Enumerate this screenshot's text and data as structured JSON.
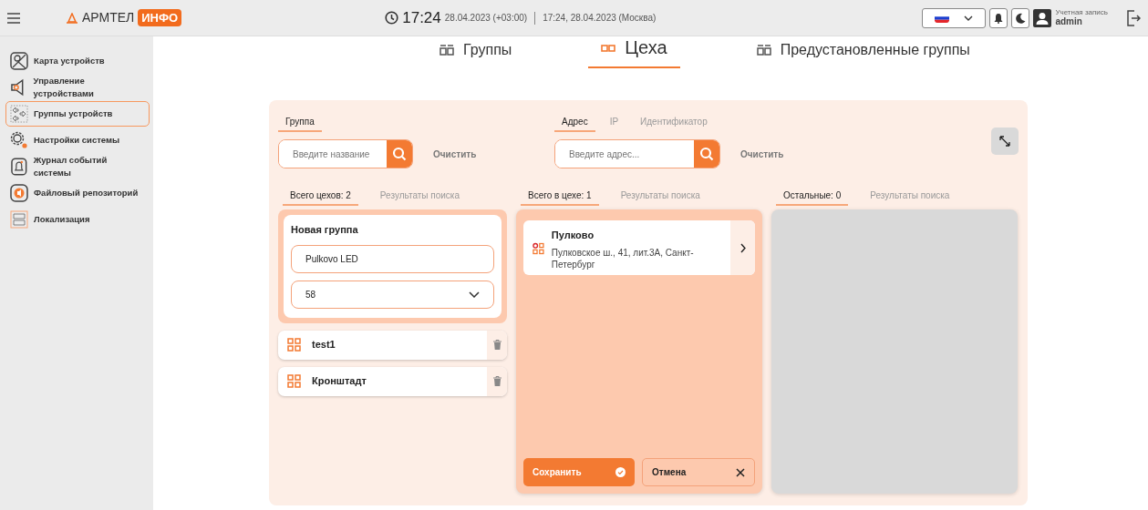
{
  "header": {
    "brand": "АРМТЕЛ",
    "brand_badge": "ИНФО",
    "time": "17:24",
    "date": "28.04.2023 (+03:00)",
    "server_time": "17:24, 28.04.2023 (Москва)",
    "account_label": "Учетная запись",
    "user": "admin"
  },
  "sidebar": {
    "items": [
      {
        "label": "Карта устройств",
        "selected": false
      },
      {
        "label": "Управление устройствами",
        "selected": false
      },
      {
        "label": "Группы устройств",
        "selected": true
      },
      {
        "label": "Настройки системы",
        "selected": false
      },
      {
        "label": "Журнал событий системы",
        "selected": false
      },
      {
        "label": "Файловый репозиторий",
        "selected": false
      },
      {
        "label": "Локализация",
        "selected": false
      }
    ]
  },
  "page_tabs": [
    {
      "label": "Группы",
      "selected": false
    },
    {
      "label": "Цеха",
      "selected": true
    },
    {
      "label": "Предустановленные группы",
      "selected": false
    }
  ],
  "filters": [
    {
      "tabs": [
        {
          "label": "Группа",
          "selected": true
        }
      ],
      "placeholder": "Введите название",
      "clear": "Очистить"
    },
    {
      "tabs": [
        {
          "label": "Адрес",
          "selected": true
        },
        {
          "label": "IP",
          "selected": false
        },
        {
          "label": "Идентификатор",
          "selected": false
        }
      ],
      "placeholder": "Введите адрес...",
      "clear": "Очистить"
    }
  ],
  "columns": [
    {
      "tabs": [
        {
          "label": "Всего цехов: 2",
          "selected": true
        },
        {
          "label": "Результаты поиска",
          "selected": false
        }
      ]
    },
    {
      "tabs": [
        {
          "label": "Всего в цехе: 1",
          "selected": true
        },
        {
          "label": "Результаты поиска",
          "selected": false
        }
      ]
    },
    {
      "tabs": [
        {
          "label": "Остальные: 0",
          "selected": true
        },
        {
          "label": "Результаты поиска",
          "selected": false
        }
      ]
    }
  ],
  "new_group": {
    "title": "Новая группа",
    "name_value": "Pulkovo LED",
    "select_value": "58"
  },
  "groups": [
    {
      "name": "test1"
    },
    {
      "name": "Кронштадт"
    }
  ],
  "devices": [
    {
      "name": "Пулково",
      "address": "Пулковское ш., 41, лит.3А, Санкт-Петербург"
    }
  ],
  "actions": {
    "save": "Сохранить",
    "cancel": "Отмена"
  }
}
